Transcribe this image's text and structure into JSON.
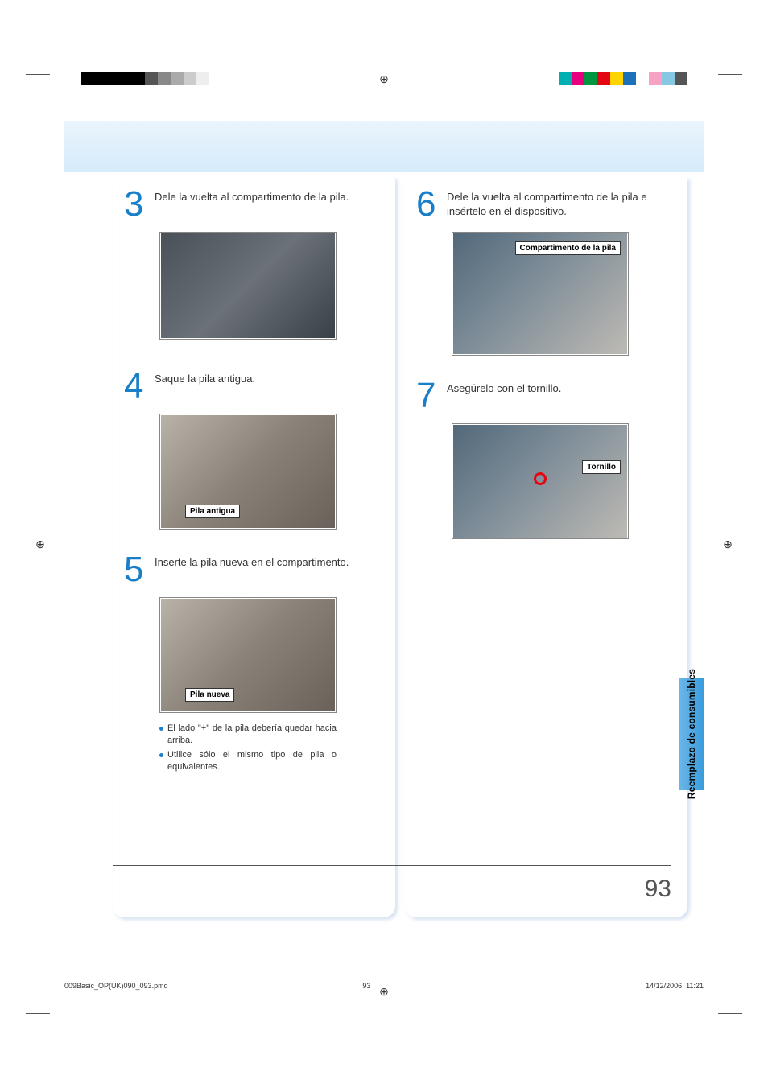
{
  "steps": [
    {
      "num": "3",
      "text": "Dele la vuelta al compartimento de la pila."
    },
    {
      "num": "4",
      "text": "Saque la pila antigua."
    },
    {
      "num": "5",
      "text": "Inserte la pila nueva en el compartimento."
    },
    {
      "num": "6",
      "text": "Dele la vuelta al compartimento de la pila e insértelo en el dispositivo."
    },
    {
      "num": "7",
      "text": "Asegúrelo con el tornillo."
    }
  ],
  "callouts": {
    "pila_antigua": "Pila antigua",
    "pila_nueva": "Pila nueva",
    "compartimento": "Compartimento de la pila",
    "tornillo": "Tornillo"
  },
  "bullets": [
    "El lado \"+\" de la pila debería quedar hacia arriba.",
    "Utilice sólo el mismo tipo de pila o equivalentes."
  ],
  "side_tab": "Reemplazo de consumibles",
  "page_number": "93",
  "footer": {
    "file": "009Basic_OP(UK)090_093.pmd",
    "page": "93",
    "datetime": "14/12/2006, 11:21"
  },
  "crop_colors": {
    "left": [
      "#000",
      "#000",
      "#000",
      "#000",
      "#000",
      "#555",
      "#888",
      "#aaa",
      "#ccc",
      "#eee",
      "#fff",
      "#fff"
    ],
    "right": [
      "#00b0b0",
      "#e6007e",
      "#009640",
      "#e30613",
      "#ffd400",
      "#1d71b8",
      "#fff",
      "#f7a1c4",
      "#86c7e3",
      "#555"
    ]
  }
}
